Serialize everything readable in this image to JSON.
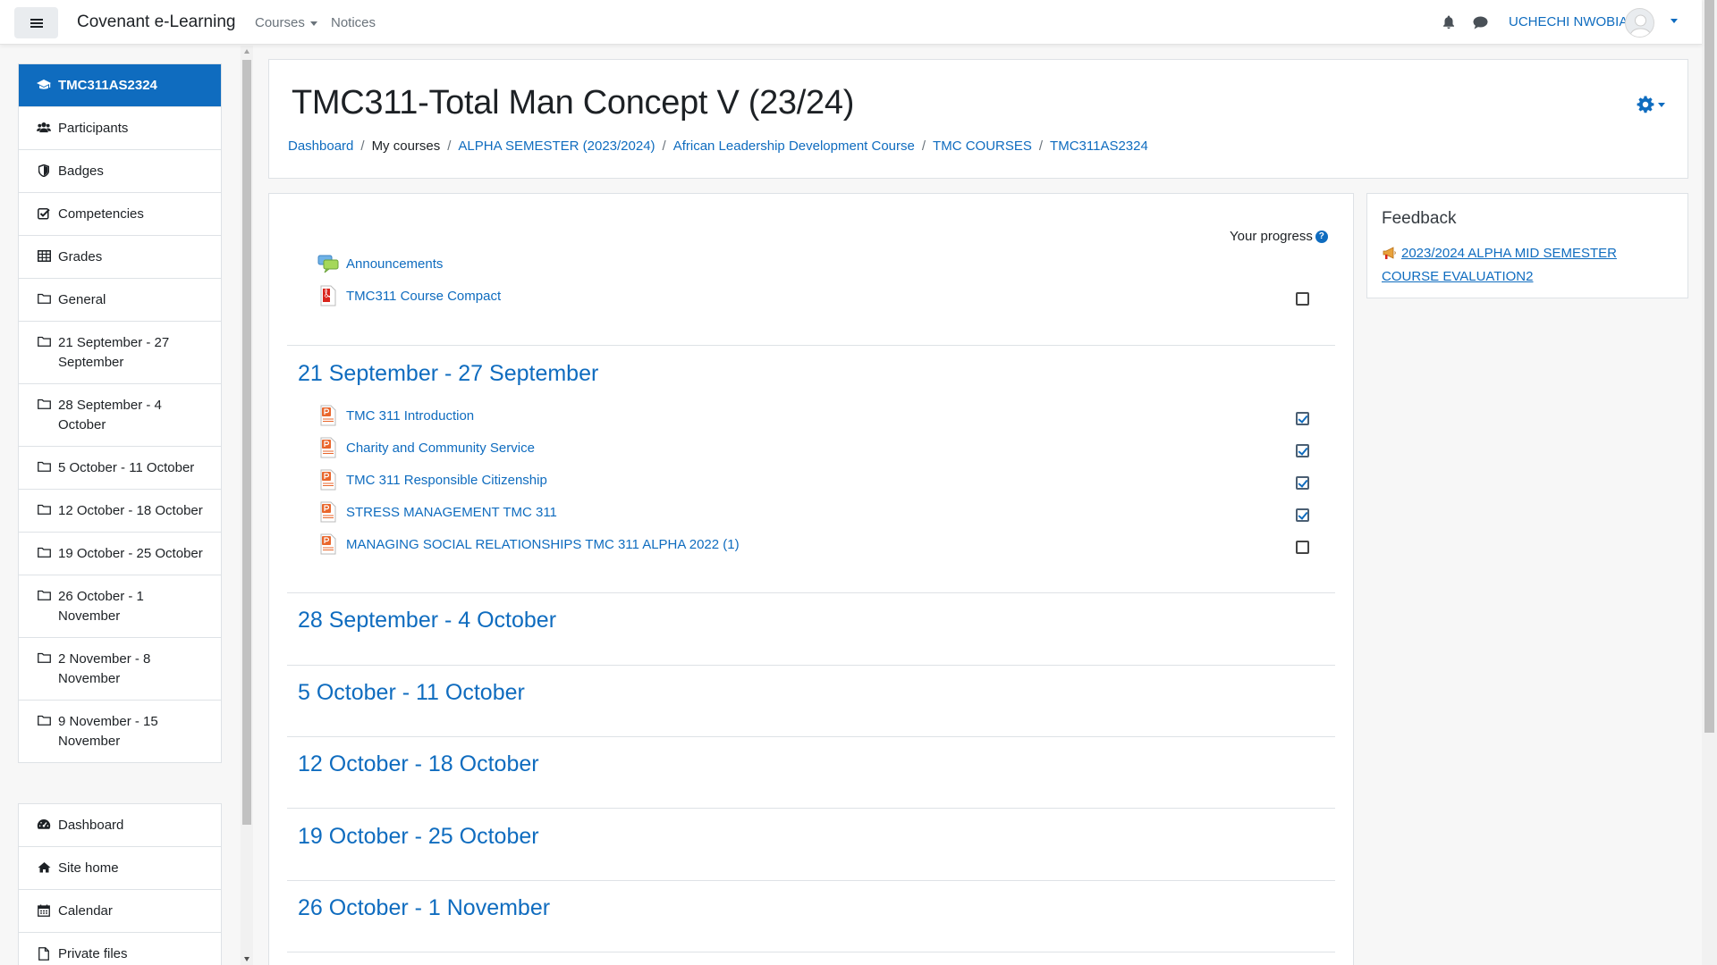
{
  "navbar": {
    "brand": "Covenant e-Learning",
    "courses_label": "Courses",
    "notices_label": "Notices",
    "username": "UCHECHI NWOBIA"
  },
  "drawer": {
    "course_items": [
      {
        "label": "TMC311AS2324",
        "icon": "graduation-cap-icon"
      },
      {
        "label": "Participants",
        "icon": "users-icon"
      },
      {
        "label": "Badges",
        "icon": "shield-icon"
      },
      {
        "label": "Competencies",
        "icon": "check-square-icon"
      },
      {
        "label": "Grades",
        "icon": "table-icon"
      },
      {
        "label": "General",
        "icon": "folder-icon"
      },
      {
        "label": "21 September - 27 September",
        "icon": "folder-icon"
      },
      {
        "label": "28 September - 4 October",
        "icon": "folder-icon"
      },
      {
        "label": "5 October - 11 October",
        "icon": "folder-icon"
      },
      {
        "label": "12 October - 18 October",
        "icon": "folder-icon"
      },
      {
        "label": "19 October - 25 October",
        "icon": "folder-icon"
      },
      {
        "label": "26 October - 1 November",
        "icon": "folder-icon"
      },
      {
        "label": "2 November - 8 November",
        "icon": "folder-icon"
      },
      {
        "label": "9 November - 15 November",
        "icon": "folder-icon"
      }
    ],
    "site_items": [
      {
        "label": "Dashboard",
        "icon": "dashboard-icon"
      },
      {
        "label": "Site home",
        "icon": "home-icon"
      },
      {
        "label": "Calendar",
        "icon": "calendar-icon"
      },
      {
        "label": "Private files",
        "icon": "file-icon"
      }
    ]
  },
  "header": {
    "title": "TMC311-Total Man Concept V (23/24)",
    "breadcrumb": [
      {
        "label": "Dashboard",
        "link": true
      },
      {
        "label": "My courses",
        "link": false
      },
      {
        "label": "ALPHA SEMESTER (2023/2024)",
        "link": true
      },
      {
        "label": "African Leadership Development Course",
        "link": true
      },
      {
        "label": "TMC COURSES",
        "link": true
      },
      {
        "label": "TMC311AS2324",
        "link": true
      }
    ]
  },
  "content": {
    "progress_label": "Your progress",
    "general_activities": [
      {
        "label": "Announcements",
        "type": "forum",
        "completion": null
      },
      {
        "label": "TMC311 Course Compact",
        "type": "pdf",
        "completion": false
      }
    ],
    "sections": [
      {
        "title": "21 September - 27 September",
        "activities": [
          {
            "label": "TMC 311 Introduction",
            "type": "ppt",
            "completion": true
          },
          {
            "label": "Charity and Community Service",
            "type": "ppt",
            "completion": true
          },
          {
            "label": "TMC 311 Responsible Citizenship",
            "type": "ppt",
            "completion": true
          },
          {
            "label": "STRESS MANAGEMENT TMC 311",
            "type": "ppt",
            "completion": true
          },
          {
            "label": "MANAGING SOCIAL RELATIONSHIPS TMC 311 ALPHA 2022 (1)",
            "type": "ppt",
            "completion": false
          }
        ]
      },
      {
        "title": "28 September - 4 October",
        "activities": []
      },
      {
        "title": "5 October - 11 October",
        "activities": []
      },
      {
        "title": "12 October - 18 October",
        "activities": []
      },
      {
        "title": "19 October - 25 October",
        "activities": []
      },
      {
        "title": "26 October - 1 November",
        "activities": []
      }
    ]
  },
  "feedback": {
    "title": "Feedback",
    "link_label": "2023/2024 ALPHA MID SEMESTER COURSE EVALUATION2"
  },
  "colors": {
    "primary": "#0f6cbf",
    "text": "#1d2125",
    "border": "#dee2e6"
  }
}
